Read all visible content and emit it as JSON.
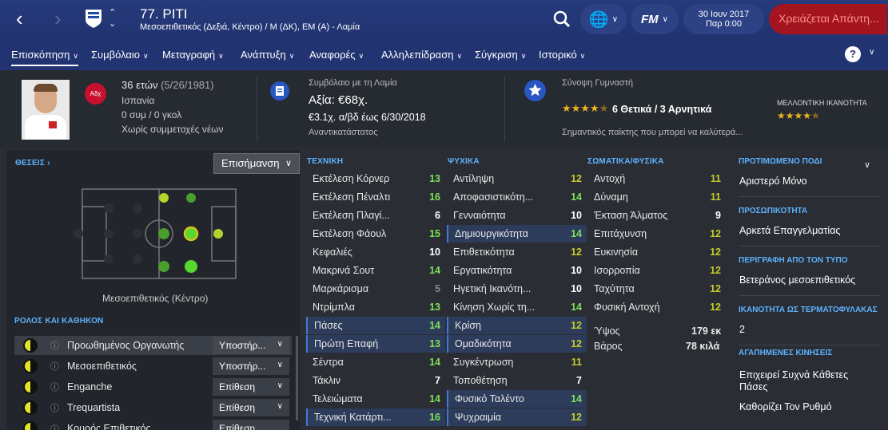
{
  "header": {
    "title": "77. PITI",
    "subtitle": "Μεσοεπιθετικός (Δεξιά, Κέντρο) / Μ (ΔΚ), ΕΜ (Α) - Λαμία",
    "date": "30 Ιουν 2017",
    "time": "Παρ 0:00",
    "alert": "Χρειάζεται Απάντη...",
    "fm_label": "FM"
  },
  "tabs": [
    "Επισκόπηση",
    "Συμβόλαιο",
    "Μεταγραφή",
    "Ανάπτυξη",
    "Αναφορές",
    "Αλληλεπίδραση",
    "Σύγκριση",
    "Ιστορικό"
  ],
  "info": {
    "age": "36 ετών",
    "dob": "(5/26/1981)",
    "nation": "Ισπανία",
    "caps": "0 συμ / 0 γκολ",
    "youth": "Χωρίς συμμετοχές νέων",
    "badge": "Αδχ",
    "contract_label": "Συμβόλαιο με τη Λαμία",
    "value": "Αξία: €68χ.",
    "wage": "€3.1χ. α/βδ έως 6/30/2018",
    "squad_status": "Αναντικατάστατος",
    "coach_label": "Σύνοψη Γυμναστή",
    "coach_summary": "6 Θετικά / 3 Αρνητικά",
    "coach_note": "Σημαντικός παίκτης που μπορεί να καλύτερά...",
    "future_label": "ΜΕΛΛΟΝΤΙΚΗ ΙΚΑΝΟΤΗΤΑ",
    "current_stars": 4.5,
    "future_stars": 4.5
  },
  "left": {
    "positions_label": "ΘΕΣΕΙΣ",
    "highlight_btn": "Επισήμανση",
    "position_name": "Μεσοεπιθετικός (Κέντρο)",
    "roles_label": "ΡΟΛΟΣ ΚΑΙ ΚΑΘΗΚΟΝ",
    "roles": [
      {
        "name": "Προωθημένος Οργανωτής",
        "duty": "Υποστήρ..."
      },
      {
        "name": "Μεσοεπιθετικός",
        "duty": "Υποστήρ..."
      },
      {
        "name": "Enganche",
        "duty": "Επίθεση"
      },
      {
        "name": "Trequartista",
        "duty": "Επίθεση"
      },
      {
        "name": "Κουρός Επιθετικός",
        "duty": "Επίθεση"
      }
    ]
  },
  "technical": {
    "label": "ΤΕΧΝΙΚΗ",
    "items": [
      {
        "n": "Εκτέλεση Κόρνερ",
        "v": "13"
      },
      {
        "n": "Εκτέλεση Πέναλτι",
        "v": "16"
      },
      {
        "n": "Εκτέλεση Πλαγί...",
        "v": "6"
      },
      {
        "n": "Εκτέλεση Φάουλ",
        "v": "15"
      },
      {
        "n": "Κεφαλιές",
        "v": "10"
      },
      {
        "n": "Μακρινά Σουτ",
        "v": "14"
      },
      {
        "n": "Μαρκάρισμα",
        "v": "5"
      },
      {
        "n": "Ντρίμπλα",
        "v": "13"
      },
      {
        "n": "Πάσες",
        "v": "14"
      },
      {
        "n": "Πρώτη Επαφή",
        "v": "13"
      },
      {
        "n": "Σέντρα",
        "v": "14"
      },
      {
        "n": "Τάκλιν",
        "v": "7"
      },
      {
        "n": "Τελειώματα",
        "v": "14"
      },
      {
        "n": "Τεχνική Κατάρτι...",
        "v": "16"
      }
    ]
  },
  "mental": {
    "label": "ΨΥΧΙΚΑ",
    "items": [
      {
        "n": "Αντίληψη",
        "v": "12"
      },
      {
        "n": "Αποφασιστικότη...",
        "v": "14"
      },
      {
        "n": "Γενναιότητα",
        "v": "10"
      },
      {
        "n": "Δημιουργικότητα",
        "v": "14"
      },
      {
        "n": "Επιθετικότητα",
        "v": "12"
      },
      {
        "n": "Εργατικότητα",
        "v": "10"
      },
      {
        "n": "Ηγετική Ικανότη...",
        "v": "10"
      },
      {
        "n": "Κίνηση Χωρίς τη...",
        "v": "14"
      },
      {
        "n": "Κρίση",
        "v": "12"
      },
      {
        "n": "Ομαδικότητα",
        "v": "12"
      },
      {
        "n": "Συγκέντρωση",
        "v": "11"
      },
      {
        "n": "Τοποθέτηση",
        "v": "7"
      },
      {
        "n": "Φυσικό Ταλέντο",
        "v": "14"
      },
      {
        "n": "Ψυχραιμία",
        "v": "12"
      }
    ]
  },
  "physical": {
    "label": "ΣΩΜΑΤΙΚΑ/ΦΥΣΙΚΑ",
    "items": [
      {
        "n": "Αντοχή",
        "v": "11"
      },
      {
        "n": "Δύναμη",
        "v": "11"
      },
      {
        "n": "Έκταση Άλματος",
        "v": "9"
      },
      {
        "n": "Επιτάχυνση",
        "v": "12"
      },
      {
        "n": "Ευκινησία",
        "v": "12"
      },
      {
        "n": "Ισορροπία",
        "v": "12"
      },
      {
        "n": "Ταχύτητα",
        "v": "12"
      },
      {
        "n": "Φυσική Αντοχή",
        "v": "12"
      }
    ],
    "height_label": "Ύψος",
    "height": "179 εκ",
    "weight_label": "Βάρος",
    "weight": "78 κιλά"
  },
  "right": [
    {
      "title": "ΠΡΟΤΙΜΩΜΕΝΟ ΠΟΔΙ",
      "value": "Αριστερό Μόνο"
    },
    {
      "title": "ΠΡΟΣΩΠΙΚΟΤΗΤΑ",
      "value": "Αρκετά Επαγγελματίας"
    },
    {
      "title": "ΠΕΡΙΓΡΑΦΗ ΑΠΟ ΤΟΝ ΤΥΠΟ",
      "value": "Βετεράνος μεσοεπιθετικός"
    },
    {
      "title": "ΙΚΑΝΟΤΗΤΑ ΩΣ ΤΕΡΜΑΤΟΦΥΛΑΚΑΣ",
      "value": "2"
    },
    {
      "title": "ΑΓΑΠΗΜΕΝΕΣ ΚΙΝΗΣΕΙΣ",
      "value": "Επιχειρεί Συχνά Κάθετες",
      "value2": "Πάσες",
      "value3": "Καθορίζει Τον Ρυθμό"
    }
  ],
  "colors": {
    "topbar": "#263a7c",
    "accent": "#5db3ff",
    "alert": "#a3141e",
    "good": "#7ee05a",
    "mid": "#c4cc2c"
  }
}
